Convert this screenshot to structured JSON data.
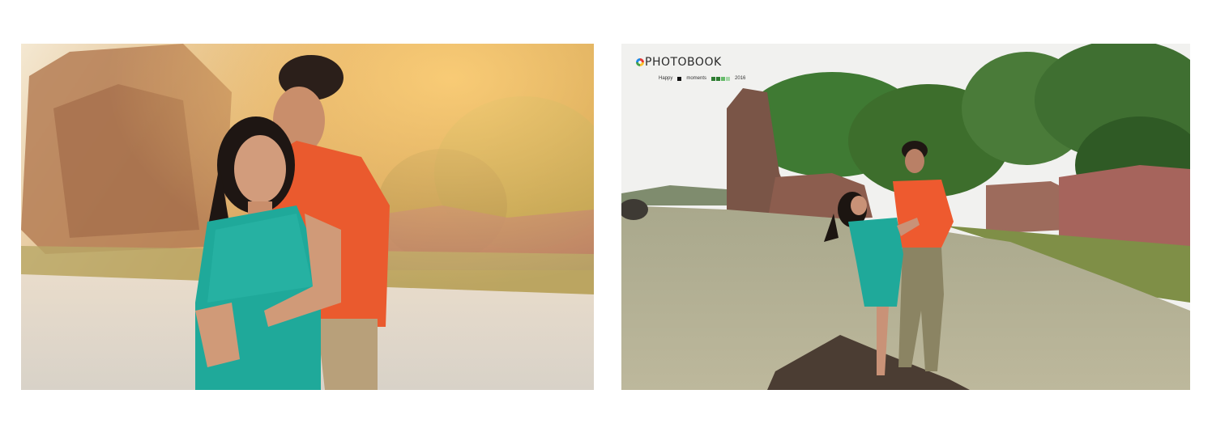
{
  "spread": {
    "left_photo": {
      "icon": "couple-embrace-sunset-photo"
    },
    "right_photo": {
      "icon": "couple-dancing-on-rock-photo",
      "brand": {
        "name": "PHOTOBOOK",
        "logo_icon": "color-ring-icon",
        "tag_left": "Happy",
        "tag_mid": "moments",
        "year": "2016"
      }
    }
  }
}
